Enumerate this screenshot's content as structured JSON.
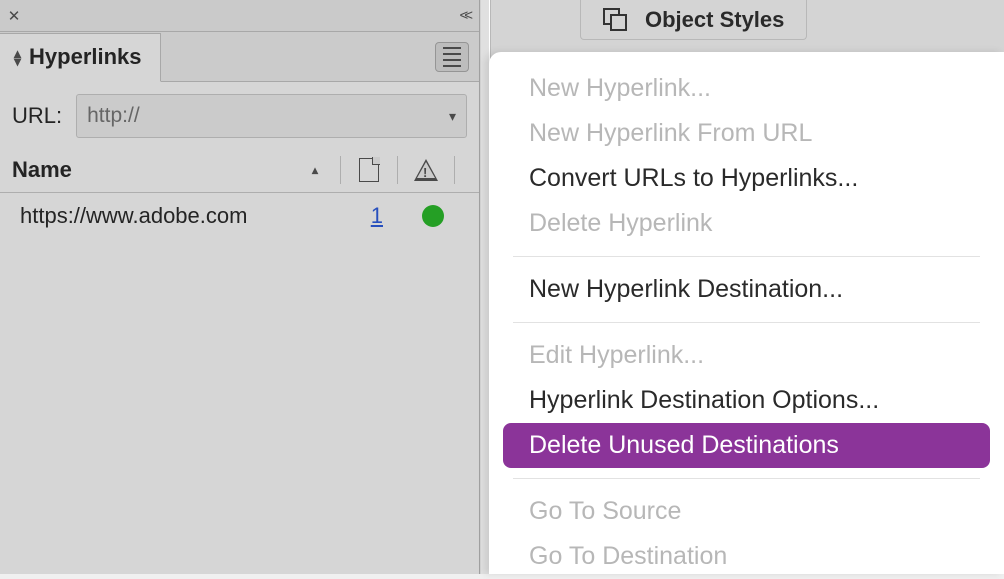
{
  "panel": {
    "tab_title": "Hyperlinks",
    "url_label": "URL:",
    "url_placeholder": "http://",
    "columns": {
      "name": "Name"
    },
    "rows": [
      {
        "name": "https://www.adobe.com",
        "count": "1",
        "status": "ok"
      }
    ]
  },
  "right_panel": {
    "tab_label": "Object Styles"
  },
  "menu": {
    "items": [
      {
        "label": "New Hyperlink...",
        "enabled": false
      },
      {
        "label": "New Hyperlink From URL",
        "enabled": false
      },
      {
        "label": "Convert URLs to Hyperlinks...",
        "enabled": true
      },
      {
        "label": "Delete Hyperlink",
        "enabled": false
      },
      {
        "type": "separator"
      },
      {
        "label": "New Hyperlink Destination...",
        "enabled": true
      },
      {
        "type": "separator"
      },
      {
        "label": "Edit Hyperlink...",
        "enabled": false
      },
      {
        "label": "Hyperlink Destination Options...",
        "enabled": true
      },
      {
        "label": "Delete Unused Destinations",
        "enabled": true,
        "highlighted": true
      },
      {
        "type": "separator"
      },
      {
        "label": "Go To Source",
        "enabled": false
      },
      {
        "label": "Go To Destination",
        "enabled": false
      }
    ]
  }
}
